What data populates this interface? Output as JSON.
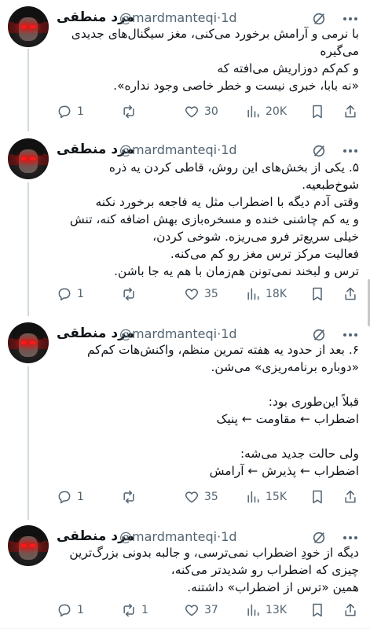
{
  "author": {
    "name": "مرد منطقی",
    "handle": "@mardmanteqi",
    "separator": "·",
    "time": "1d"
  },
  "tweets": [
    {
      "lines": [
        "با نرمی و آرامش برخورد می‌کنی، مغز سیگنال‌های جدیدی",
        "می‌گیره",
        "و کم‌کم دوزاریش می‌افته که",
        "«نه بابا، خبری نیست و خطر خاصی وجود نداره»."
      ],
      "replies": "1",
      "retweets": "",
      "likes": "30",
      "views": "20K"
    },
    {
      "lines": [
        "۵. یکی از بخش‌های این روش، قاطی کردن یه ذره",
        "شوخ‌طبعیه.",
        "وقتی آدم دیگه با اضطراب مثل یه فاجعه برخورد نکنه",
        "و یه کم چاشنی خنده و مسخره‌بازی بهش اضافه کنه، تنش",
        "خیلی سریع‌تر فرو می‌ریزه. شوخی کردن،",
        "فعالیت مرکز ترس مغز رو کم می‌کنه.",
        "ترس و لبخند نمی‌تونن هم‌زمان با هم یه جا باشن."
      ],
      "replies": "1",
      "retweets": "",
      "likes": "35",
      "views": "18K"
    },
    {
      "lines": [
        "۶. بعد از حدود یه هفته تمرین منظم، واکنش‌هات کم‌کم",
        "«دوباره برنامه‌ریزی» می‌شن.",
        "",
        "قبلاً این‌طوری بود:",
        "اضطراب ← مقاومت ← پنیک",
        "",
        "ولی حالت جدید می‌شه:",
        "اضطراب ← پذیرش ← آرامش"
      ],
      "replies": "1",
      "retweets": "",
      "likes": "35",
      "views": "15K"
    },
    {
      "lines": [
        "دیگه از خودِ اضطراب نمی‌ترسی، و جالبه بدونی بزرگ‌ترین",
        "چیزی که اضطراب رو شدیدتر می‌کنه،",
        "همین «ترس از اضطراب» داشتنه."
      ],
      "replies": "1",
      "retweets": "1",
      "likes": "37",
      "views": "13K"
    }
  ],
  "icons": {
    "reply": "reply-icon",
    "retweet": "retweet-icon",
    "like": "heart-icon",
    "views": "views-icon",
    "bookmark": "bookmark-icon",
    "share": "share-icon",
    "grok": "grok-icon",
    "more": "more-icon"
  },
  "colors": {
    "text": "#0f1419",
    "muted": "#536471",
    "thread_line": "#cfd9de",
    "divider": "#eff3f4"
  }
}
